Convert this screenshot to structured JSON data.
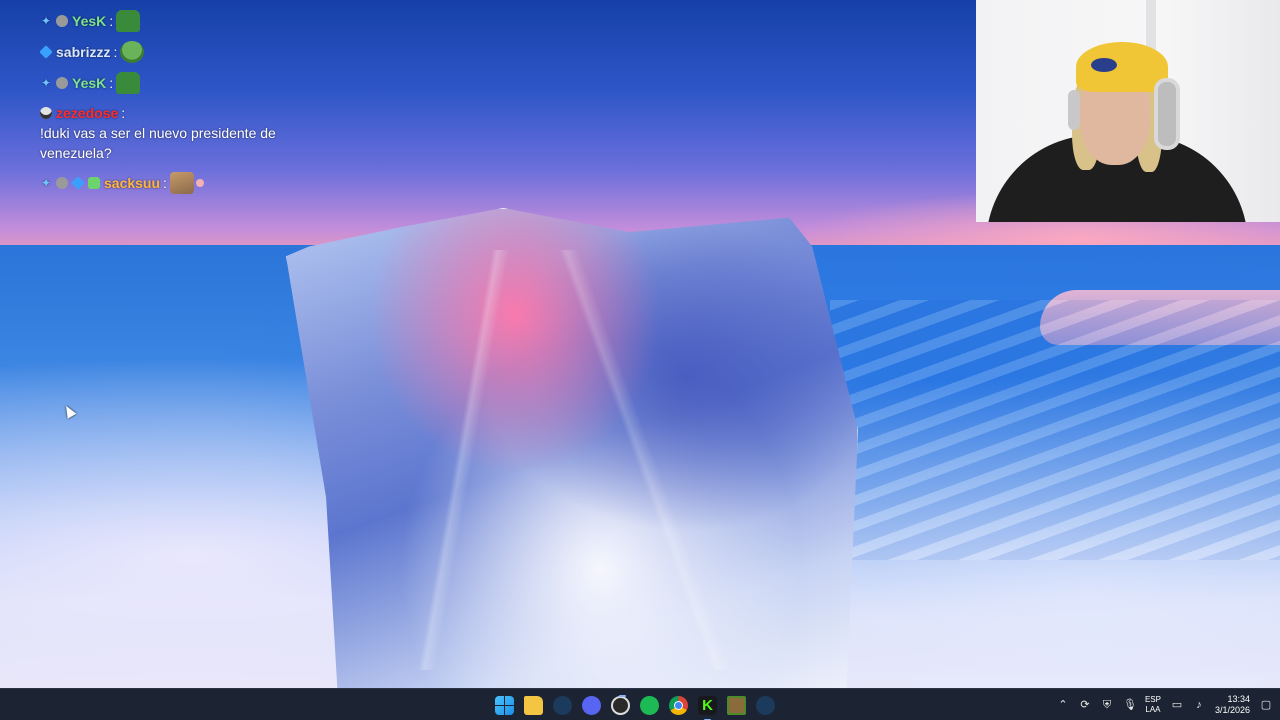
{
  "chat": {
    "messages": [
      {
        "badges": [
          "sword-badge",
          "gray-badge"
        ],
        "user": "YesK",
        "user_color": "#7ee28a",
        "text": "",
        "emote": "pepe-emote"
      },
      {
        "badges": [
          "cube-badge"
        ],
        "user": "sabrizzz",
        "user_color": "#d9e6ff",
        "text": "",
        "emote": "pepe-face-emote"
      },
      {
        "badges": [
          "sword-badge",
          "gray-badge"
        ],
        "user": "YesK",
        "user_color": "#7ee28a",
        "text": "",
        "emote": "pepe-emote"
      },
      {
        "badges": [
          "mask-badge"
        ],
        "user": "zezedose",
        "user_color": "#ff2b2b",
        "text": "!duki vas a ser el nuevo presidente de venezuela?",
        "emote": ""
      },
      {
        "badges": [
          "sword-badge",
          "gray-badge",
          "cube-badge",
          "bot-badge"
        ],
        "user": "sacksuu",
        "user_color": "#ffb63a",
        "text": "",
        "emote": "cat-emote"
      }
    ],
    "separator": ":"
  },
  "webcam": {
    "label": ""
  },
  "taskbar": {
    "apps": [
      {
        "name": "start",
        "icon": "windows-icon"
      },
      {
        "name": "file-explorer",
        "icon": "folder-icon"
      },
      {
        "name": "steam",
        "icon": "steam-icon"
      },
      {
        "name": "discord",
        "icon": "discord-icon"
      },
      {
        "name": "obs",
        "icon": "obs-icon"
      },
      {
        "name": "spotify",
        "icon": "spotify-icon"
      },
      {
        "name": "chrome",
        "icon": "chrome-icon"
      },
      {
        "name": "kick",
        "icon": "kick-icon",
        "glyph": "K"
      },
      {
        "name": "minecraft",
        "icon": "minecraft-icon"
      },
      {
        "name": "steam-2",
        "icon": "steam-icon"
      }
    ],
    "tray": {
      "language_top": "ESP",
      "language_bottom": "LAA",
      "time": "13:34",
      "date": "3/1/2026"
    }
  },
  "colors": {
    "taskbar_bg": "#1c2433",
    "accent": "#4cc2ff"
  }
}
